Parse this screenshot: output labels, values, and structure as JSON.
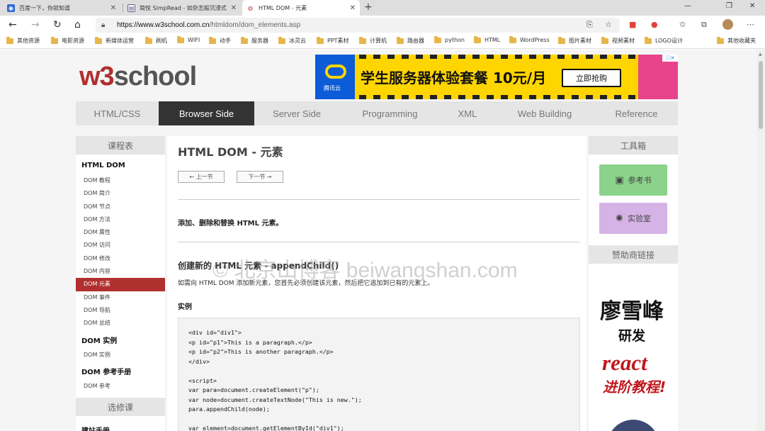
{
  "tabs": [
    {
      "title": "百度一下，你就知道",
      "icon": "baidu-icon"
    },
    {
      "title": "简悦 SimpRead - 如杂志般沉浸式",
      "icon": "simpread-icon"
    },
    {
      "title": "HTML DOM - 元素",
      "icon": "w3school-icon"
    }
  ],
  "address": {
    "host": "https://www.w3school.com.cn",
    "path": "/htmldom/dom_elements.asp"
  },
  "bookmarks": [
    "其他资源",
    "电影资源",
    "新媒体运营",
    "刷机",
    "WIFI",
    "动手",
    "服务器",
    "冰灵云",
    "PPT素材",
    "计算机",
    "路由器",
    "python",
    "HTML",
    "WordPress",
    "图片素材",
    "视频素材",
    "LOGO设计"
  ],
  "bookmarks_other": "其他收藏夹",
  "logo": {
    "w3": "w3",
    "rest": "school"
  },
  "ad": {
    "brand": "腾讯云",
    "headline": "学生服务器体验套餐 10元/月",
    "cta": "立即抢购"
  },
  "topnav": [
    "HTML/CSS",
    "Browser Side",
    "Server Side",
    "Programming",
    "XML",
    "Web Building",
    "Reference"
  ],
  "topnav_active": "Browser Side",
  "left": {
    "header": "课程表",
    "sec1": "HTML DOM",
    "links1": [
      "DOM 教程",
      "DOM 简介",
      "DOM 节点",
      "DOM 方法",
      "DOM 属性",
      "DOM 访问",
      "DOM 修改",
      "DOM 内容",
      "DOM 元素",
      "DOM 事件",
      "DOM 导航",
      "DOM 总结"
    ],
    "active": "DOM 元素",
    "sec2": "DOM 实例",
    "links2": [
      "DOM 实例"
    ],
    "sec3": "DOM 参考手册",
    "links3": [
      "DOM 参考"
    ],
    "header2": "选修课",
    "sec4": "建站手册"
  },
  "main": {
    "title": "HTML DOM - 元素",
    "prev": "上一节",
    "next": "下一节",
    "intro": "添加、删除和替换 HTML 元素。",
    "h2": "创建新的 HTML 元素 - appendChild()",
    "para": "如需向 HTML DOM 添加新元素，您首先必须创建该元素，然后把它追加到已有的元素上。",
    "example": "实例",
    "code": "<div id=\"div1\">\n<p id=\"p1\">This is a paragraph.</p>\n<p id=\"p2\">This is another paragraph.</p>\n</div>\n\n<script>\nvar para=document.createElement(\"p\");\nvar node=document.createTextNode(\"This is new.\");\npara.appendChild(node);\n\nvar element=document.getElementById(\"div1\");"
  },
  "right": {
    "header": "工具箱",
    "ref": "参考书",
    "lab": "实验室",
    "sponsor": "赞助商链接",
    "ad_line1": "廖雪峰",
    "ad_line2": "研发",
    "ad_line3": "react",
    "ad_line4": "进阶教程!"
  },
  "watermark": "© 北京山博客 beiwangshan.com"
}
